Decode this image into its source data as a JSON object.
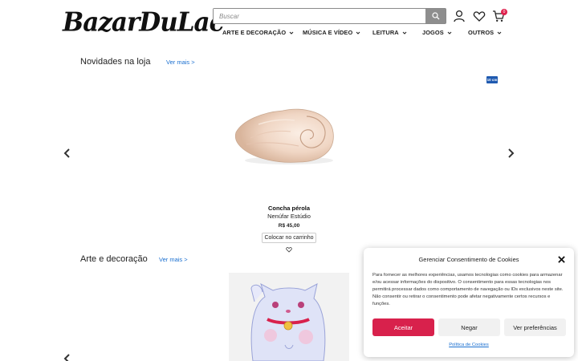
{
  "header": {
    "logo_text": "BazarDuLac",
    "search_placeholder": "Buscar",
    "cart_count": "0"
  },
  "nav": {
    "items": [
      {
        "label": "ARTE E DECORAÇÃO"
      },
      {
        "label": "MÚSICA E VÍDEO"
      },
      {
        "label": "LEITURA"
      },
      {
        "label": "JOGOS"
      },
      {
        "label": "OUTROS"
      }
    ]
  },
  "novidades": {
    "title": "Novidades na loja",
    "see_more": "Ver mais >",
    "badge": "10 cm",
    "product": {
      "name": "Concha pérola",
      "brand": "Nenúfar Estúdio",
      "price": "R$ 45,00",
      "add_to_cart": "Colocar no carrinho"
    }
  },
  "arte": {
    "title": "Arte e decoração",
    "see_more": "Ver mais >"
  },
  "cookie": {
    "title": "Gerenciar Consentimento de Cookies",
    "body": "Para fornecer as melhores experiências, usamos tecnologias como cookies para armazenar e/ou acessar informações do dispositivo. O consentimento para essas tecnologias nos permitirá processar dados como comportamento de navegação ou IDs exclusivos neste site. Não consentir ou retirar o consentimento pode afetar negativamente certos recursos e funções.",
    "accept": "Aceitar",
    "deny": "Negar",
    "preferences": "Ver preferências",
    "policy": "Política de Cookies"
  },
  "colors": {
    "accent": "#d8214c",
    "link": "#1a6fd0",
    "badge": "#1f5ab0"
  }
}
